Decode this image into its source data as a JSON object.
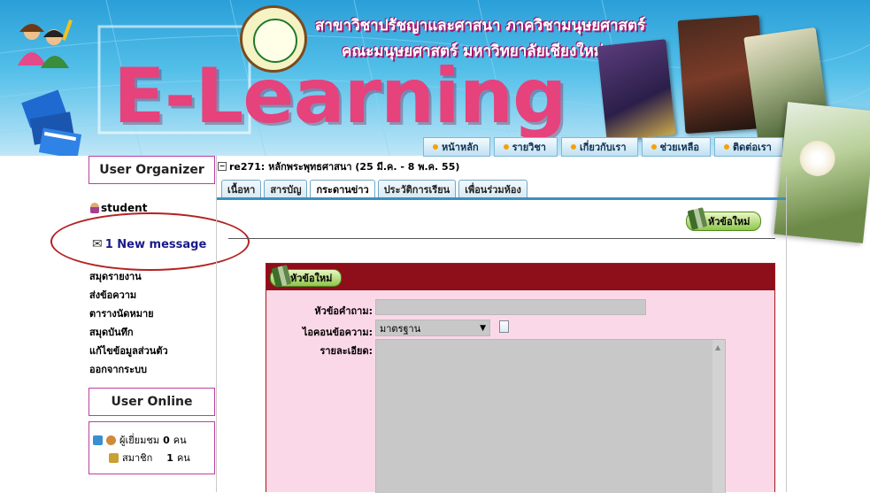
{
  "banner": {
    "logo": "E-Learning",
    "title_line1": "สาขาวิชาปรัชญาและศาสนา ภาควิชามนุษยศาสตร์",
    "title_line2": "คณะมนุษยศาสตร์ มหาวิทยาลัยเชียงใหม่"
  },
  "nav": {
    "items": [
      {
        "label": "หน้าหลัก"
      },
      {
        "label": "รายวิชา"
      },
      {
        "label": "เกี่ยวกับเรา"
      },
      {
        "label": "ช่วยเหลือ"
      },
      {
        "label": "ติดต่อเรา"
      }
    ],
    "bullet_color": "#f6a10a"
  },
  "sidebar": {
    "organizer_title": "User Organizer",
    "username": "student",
    "new_message": "1 New message",
    "menu": [
      {
        "label": "สมุดรายงาน"
      },
      {
        "label": "ส่งข้อความ"
      },
      {
        "label": "ตารางนัดหมาย"
      },
      {
        "label": "สมุดบันทึก"
      },
      {
        "label": "แก้ไขข้อมูลส่วนตัว"
      },
      {
        "label": "ออกจากระบบ"
      }
    ],
    "online_title": "User Online",
    "visitors_label": "ผู้เยี่ยมชม",
    "visitors_count": "0",
    "visitors_unit": "คน",
    "members_label": "สมาชิก",
    "members_count": "1",
    "members_unit": "คน",
    "border_color": "#bb3fa3"
  },
  "course": {
    "title": "re271: หลักพระพุทธศาสนา (25 มี.ค. - 8 พ.ค. 55)"
  },
  "tabs": [
    {
      "label": "เนื้อหา",
      "active": false
    },
    {
      "label": "สารบัญ",
      "active": false
    },
    {
      "label": "กระดานข่าว",
      "active": true
    },
    {
      "label": "ประวัติการเรียน",
      "active": false
    },
    {
      "label": "เพื่อนร่วมห้อง",
      "active": false
    }
  ],
  "board": {
    "new_topic_label": "หัวข้อใหม่",
    "panel_new_topic_label": "หัวข้อใหม่",
    "subject_label": "หัวข้อคำถาม:",
    "subject_value": "",
    "icon_label": "ไอคอนข้อความ:",
    "icon_selected": "มาตรฐาน",
    "detail_label": "รายละเอียด:",
    "detail_value": "",
    "panel_header_color": "#8e0e1a",
    "panel_bg_color": "#fbd8e8"
  },
  "annotation": {
    "ellipse_color": "#b52222"
  }
}
